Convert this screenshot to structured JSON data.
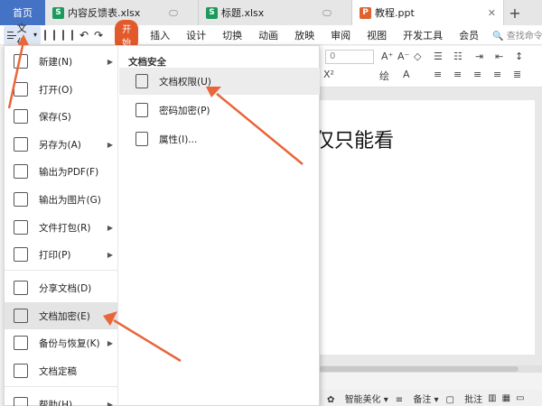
{
  "tabs": {
    "home": "首页",
    "docs": [
      {
        "label": "内容反馈表.xlsx",
        "type": "xls",
        "badge": "S"
      },
      {
        "label": "标题.xlsx",
        "type": "xls",
        "badge": "S"
      },
      {
        "label": "教程.ppt",
        "type": "ppt",
        "badge": "P"
      }
    ],
    "add": "+"
  },
  "menubar": {
    "file": "文件",
    "start": "开始",
    "items": [
      "插入",
      "设计",
      "切换",
      "动画",
      "放映",
      "审阅",
      "视图",
      "开发工具",
      "会员"
    ],
    "search": "查找命令"
  },
  "toolbar": {
    "font_size": "0"
  },
  "file_menu": {
    "items": [
      {
        "label": "新建(N)",
        "icon": "new-file-icon",
        "arrow": true
      },
      {
        "label": "打开(O)",
        "icon": "folder-icon",
        "arrow": false
      },
      {
        "label": "保存(S)",
        "icon": "save-icon",
        "arrow": false
      },
      {
        "label": "另存为(A)",
        "icon": "save-as-icon",
        "arrow": true
      },
      {
        "label": "输出为PDF(F)",
        "icon": "pdf-icon",
        "arrow": false
      },
      {
        "label": "输出为图片(G)",
        "icon": "image-icon",
        "arrow": false
      },
      {
        "label": "文件打包(R)",
        "icon": "package-icon",
        "arrow": true
      },
      {
        "label": "打印(P)",
        "icon": "print-icon",
        "arrow": true
      },
      {
        "label": "分享文档(D)",
        "icon": "share-icon",
        "arrow": false
      },
      {
        "label": "文档加密(E)",
        "icon": "encrypt-icon",
        "arrow": true
      },
      {
        "label": "备份与恢复(K)",
        "icon": "backup-icon",
        "arrow": true
      },
      {
        "label": "文档定稿",
        "icon": "finalize-icon",
        "arrow": false
      },
      {
        "label": "帮助(H)",
        "icon": "help-icon",
        "arrow": true
      }
    ],
    "active_index": 9
  },
  "sub_menu": {
    "title": "文档安全",
    "items": [
      {
        "label": "文档权限(U)",
        "icon": "permission-icon"
      },
      {
        "label": "密码加密(P)",
        "icon": "password-icon"
      },
      {
        "label": "属性(I)...",
        "icon": "properties-icon"
      }
    ]
  },
  "slide": {
    "text": "仅只能看"
  },
  "statusbar": {
    "beautify": "智能美化",
    "notes": "备注",
    "comments": "批注"
  },
  "colors": {
    "accent": "#4472c4",
    "start_button": "#e25a2b",
    "arrow": "#e8663a"
  }
}
